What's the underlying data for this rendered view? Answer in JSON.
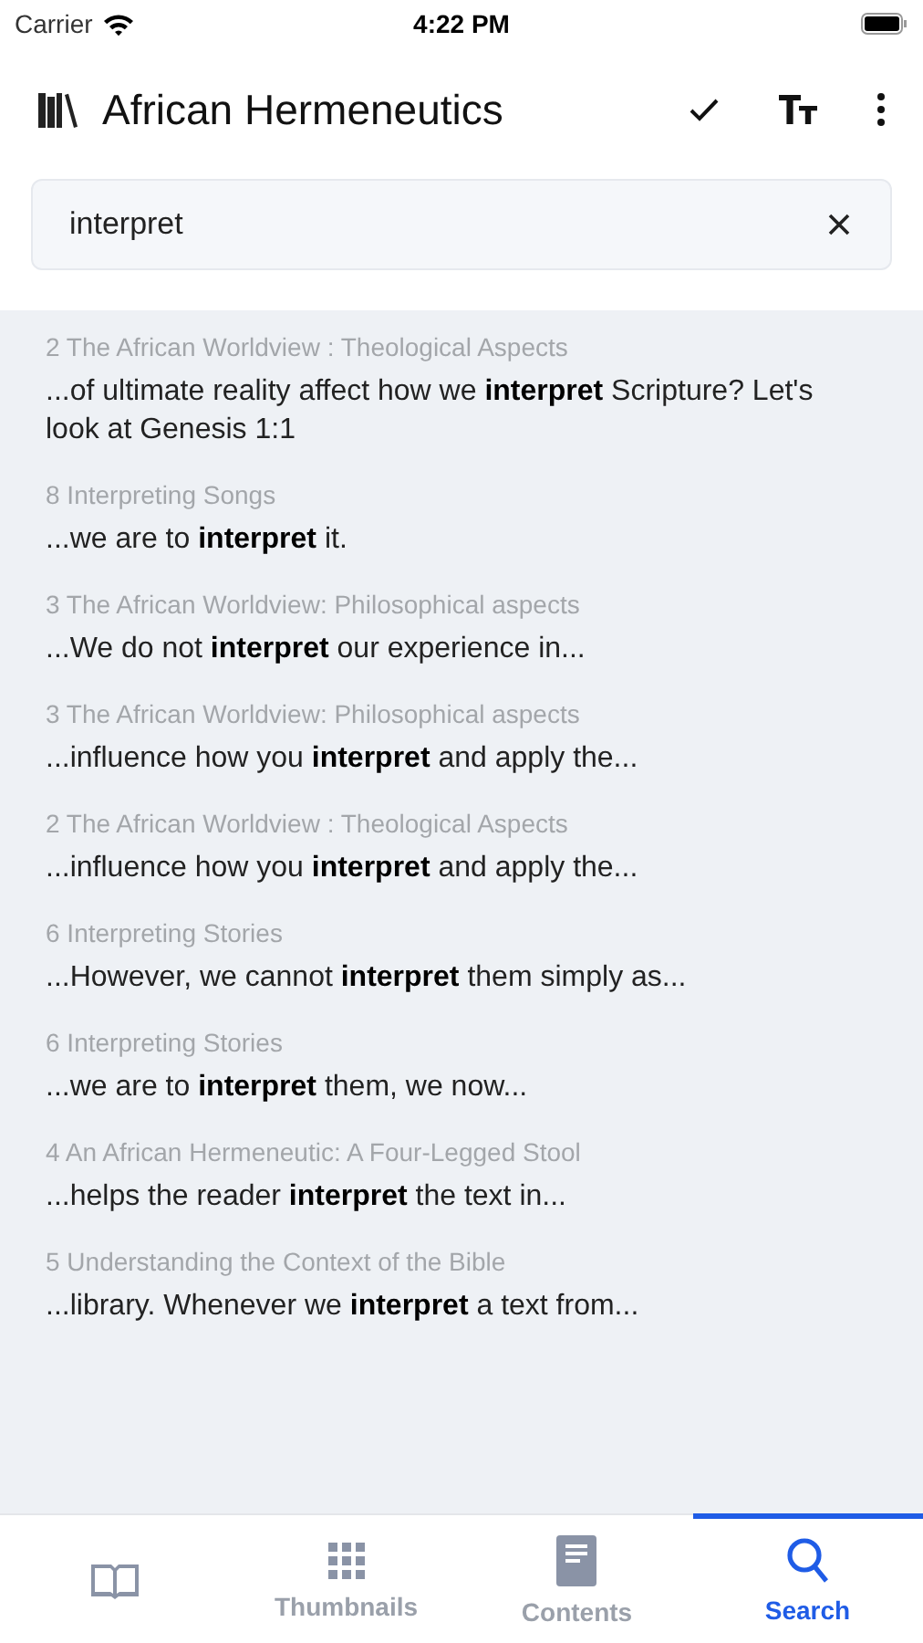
{
  "status_bar": {
    "carrier": "Carrier",
    "time": "4:22 PM"
  },
  "header": {
    "title": "African Hermeneutics"
  },
  "search": {
    "value": "interpret"
  },
  "results": [
    {
      "chapter": "2 The African Worldview : Theological Aspects",
      "snippet": "...of ultimate reality affect how we **interpret** Scripture? Let's look at Genesis 1:1"
    },
    {
      "chapter": "8 Interpreting Songs",
      "snippet": "...we are to **interpret** it."
    },
    {
      "chapter": "3 The African Worldview: Philosophical aspects",
      "snippet": "...We do not **interpret** our experience in..."
    },
    {
      "chapter": "3 The African Worldview: Philosophical aspects",
      "snippet": "...influence how you **interpret** and apply the..."
    },
    {
      "chapter": "2 The African Worldview : Theological Aspects",
      "snippet": "...influence how you **interpret** and apply the..."
    },
    {
      "chapter": "6 Interpreting Stories",
      "snippet": "...However, we cannot **interpret** them simply as..."
    },
    {
      "chapter": "6 Interpreting Stories",
      "snippet": "...we are to **interpret** them, we now..."
    },
    {
      "chapter": "4 An African Hermeneutic: A Four-Legged Stool",
      "snippet": "...helps the reader **interpret** the text in..."
    },
    {
      "chapter": "5 Understanding the Context of the Bible",
      "snippet": "...library. Whenever we **interpret** a text from..."
    }
  ],
  "tabs": [
    {
      "kind": "book",
      "selected": false
    },
    {
      "kind": "grid",
      "label": "Thumbnails",
      "selected": false
    },
    {
      "kind": "doc",
      "label": "Contents",
      "selected": false
    },
    {
      "kind": "search",
      "label": "Search",
      "selected": true
    }
  ]
}
